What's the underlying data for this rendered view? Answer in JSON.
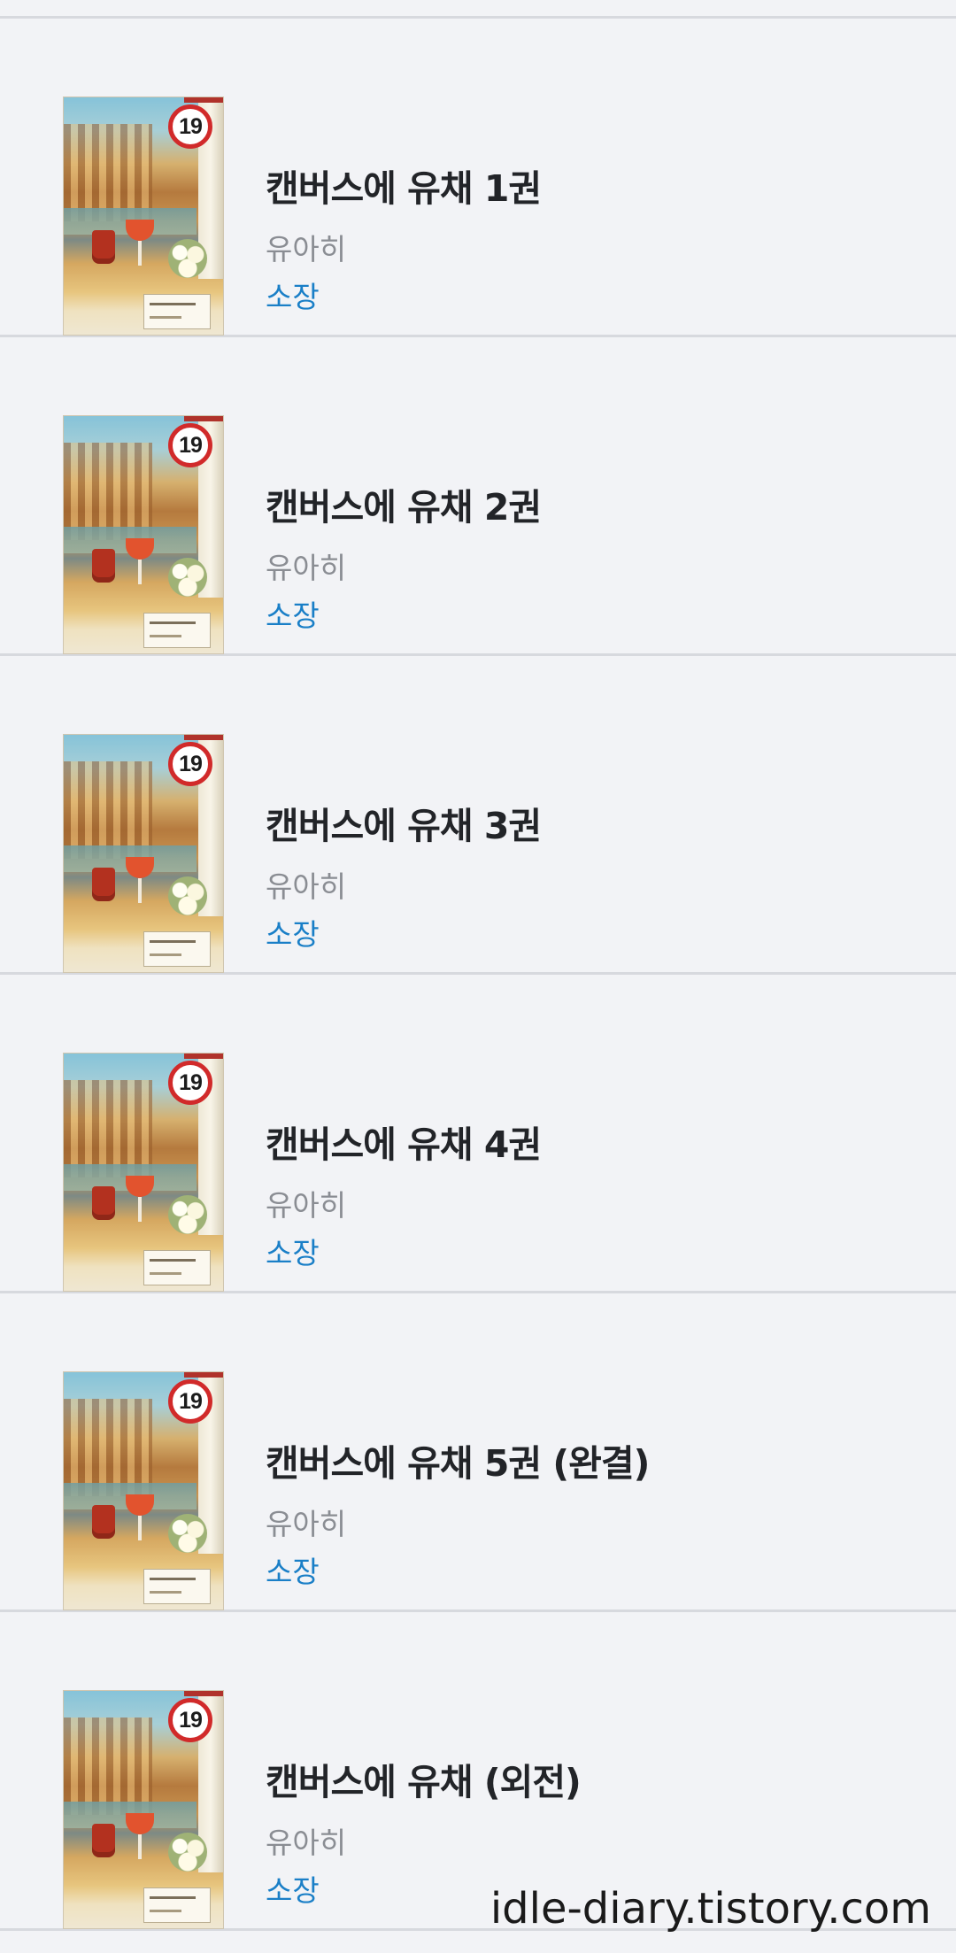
{
  "books": [
    {
      "title": "캔버스에 유채 1권",
      "author": "유아히",
      "status": "소장",
      "age_rating": "19"
    },
    {
      "title": "캔버스에 유채 2권",
      "author": "유아히",
      "status": "소장",
      "age_rating": "19"
    },
    {
      "title": "캔버스에 유채 3권",
      "author": "유아히",
      "status": "소장",
      "age_rating": "19"
    },
    {
      "title": "캔버스에 유채 4권",
      "author": "유아히",
      "status": "소장",
      "age_rating": "19"
    },
    {
      "title": "캔버스에 유채 5권 (완결)",
      "author": "유아히",
      "status": "소장",
      "age_rating": "19"
    },
    {
      "title": "캔버스에 유채 (외전)",
      "author": "유아히",
      "status": "소장",
      "age_rating": "19"
    }
  ],
  "watermark": "idle-diary.tistory.com",
  "colors": {
    "background": "#f2f3f6",
    "divider": "#d7d9de",
    "title": "#222428",
    "author": "#8a8d93",
    "status": "#1a7fc7",
    "age_badge_ring": "#d12a2a"
  },
  "icons": {
    "age_badge": "age-19-badge-icon"
  }
}
